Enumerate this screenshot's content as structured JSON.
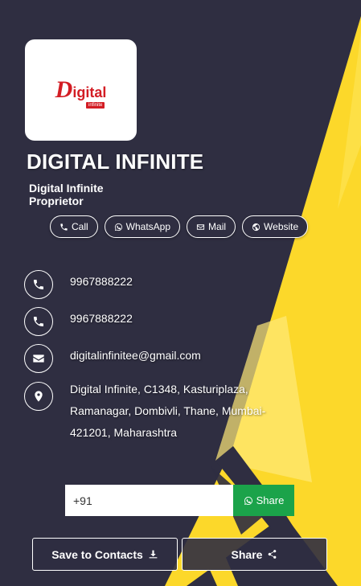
{
  "brand": {
    "logo_letter": "D",
    "logo_rest": "igital",
    "logo_sub": "infinite",
    "title": "DIGITAL INFINITE",
    "company": "Digital Infinite",
    "role": "Proprietor"
  },
  "actions": {
    "call": "Call",
    "whatsapp": "WhatsApp",
    "mail": "Mail",
    "website": "Website"
  },
  "contacts": {
    "phone1": "9967888222",
    "phone2": "9967888222",
    "email": "digitalinfinitee@gmail.com",
    "address": "Digital Infinite, C1348, Kasturiplaza, Ramanagar, Dombivli, Thane, Mumbai-421201, Maharashtra"
  },
  "share": {
    "phone_value": "+91",
    "share_label": "Share"
  },
  "buttons": {
    "save_contacts": "Save to Contacts",
    "share": "Share"
  },
  "colors": {
    "background": "#2f2e41",
    "accent_yellow": "#fcd82a",
    "whatsapp_green": "#1ba34a",
    "logo_red": "#d31d24"
  }
}
